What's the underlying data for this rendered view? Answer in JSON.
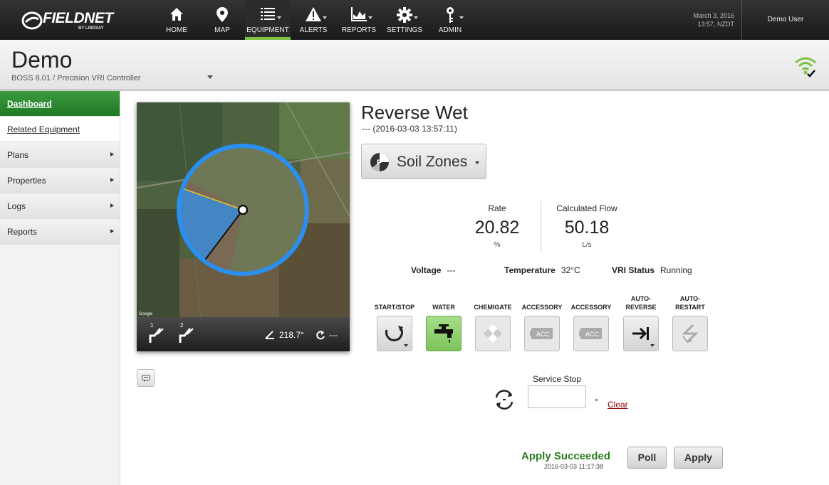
{
  "topbar": {
    "logo_text": "FIELDNET",
    "logo_sub": "BY LINDSAY",
    "nav": [
      {
        "label": "HOME",
        "icon": "home-icon"
      },
      {
        "label": "MAP",
        "icon": "map-pin-icon"
      },
      {
        "label": "EQUIPMENT",
        "icon": "list-icon",
        "active": true
      },
      {
        "label": "ALERTS",
        "icon": "alert-icon"
      },
      {
        "label": "REPORTS",
        "icon": "chart-icon"
      },
      {
        "label": "SETTINGS",
        "icon": "gear-icon"
      },
      {
        "label": "ADMIN",
        "icon": "key-icon"
      }
    ],
    "date": "March 3, 2016",
    "time": "13:57, NZDT",
    "user": "Demo User"
  },
  "header": {
    "title": "Demo",
    "subtitle": "BOSS 8.01 / Precision VRI Controller"
  },
  "sidebar": {
    "items": [
      {
        "label": "Dashboard"
      },
      {
        "label": "Related Equipment"
      },
      {
        "label": "Plans"
      },
      {
        "label": "Properties"
      },
      {
        "label": "Logs"
      },
      {
        "label": "Reports"
      }
    ]
  },
  "map": {
    "attribution": "Google",
    "zone1": "1",
    "zone2": "2",
    "angle": "218.7°",
    "rotation": "---"
  },
  "main": {
    "status_title": "Reverse Wet",
    "status_time": "--- (2016-03-03 13:57:11)",
    "soil_zones_label": "Soil Zones",
    "rate": {
      "label": "Rate",
      "value": "20.82",
      "unit": "%"
    },
    "flow": {
      "label": "Calculated Flow",
      "value": "50.18",
      "unit": "L/s"
    },
    "voltage": {
      "label": "Voltage",
      "value": "---"
    },
    "temperature": {
      "label": "Temperature",
      "value": "32°C"
    },
    "vri_status": {
      "label": "VRI Status",
      "value": "Running"
    },
    "controls": [
      {
        "label": "START/STOP"
      },
      {
        "label": "WATER"
      },
      {
        "label": "CHEMIGATE"
      },
      {
        "label": "ACCESSORY"
      },
      {
        "label": "ACCESSORY"
      },
      {
        "label": "AUTO-REVERSE"
      },
      {
        "label": "AUTO-RESTART"
      }
    ],
    "acc_text": "ACC",
    "service_stop_label": "Service Stop",
    "service_stop_value": "",
    "degree_symbol": "°",
    "clear_label": "Clear",
    "apply_status": "Apply Succeeded",
    "apply_time": "2016-03-03 11:17:38",
    "poll_label": "Poll",
    "apply_label": "Apply"
  },
  "colors": {
    "accent": "#7dc242",
    "pivot_blue": "#2a8ff0",
    "success": "#2a7d1f"
  }
}
